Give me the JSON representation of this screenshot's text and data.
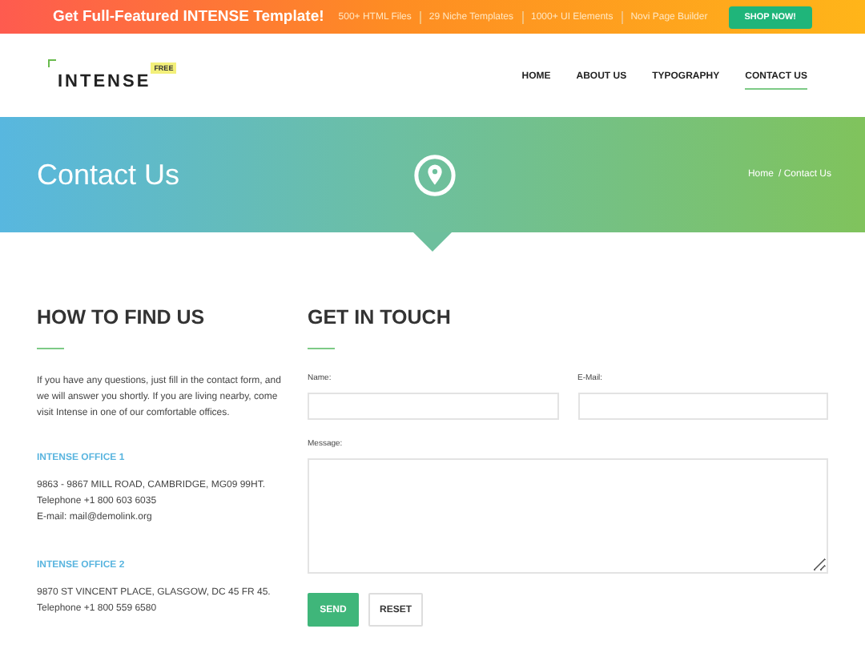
{
  "promo_bar": {
    "title": "Get Full-Featured INTENSE Template!",
    "features": [
      "500+ HTML Files",
      "29 Niche Templates",
      "1000+ UI Elements",
      "Novi Page Builder"
    ],
    "button": "SHOP NOW!"
  },
  "header": {
    "logo": "INTENSE",
    "logo_badge": "FREE",
    "nav": [
      {
        "label": "HOME",
        "selected": false
      },
      {
        "label": "ABOUT US",
        "selected": false
      },
      {
        "label": "TYPOGRAPHY",
        "selected": false
      },
      {
        "label": "CONTACT US",
        "selected": true
      }
    ]
  },
  "hero": {
    "title": "Contact Us",
    "breadcrumbs": [
      "Home",
      "/ Contact Us"
    ]
  },
  "find_us": {
    "heading": "HOW TO FIND US",
    "intro": "If you have any questions, just fill in the contact form, and we will answer you shortly. If you are living nearby, come visit Intense in one of our comfortable offices.",
    "offices": [
      {
        "name": "INTENSE OFFICE 1",
        "lines": [
          "9863 - 9867 MILL ROAD, CAMBRIDGE, MG09 99HT.",
          "Telephone +1 800 603 6035",
          "E-mail: mail@demolink.org"
        ]
      },
      {
        "name": "INTENSE OFFICE 2",
        "lines": [
          "9870 ST VINCENT PLACE, GLASGOW, DC 45 FR 45.",
          "Telephone +1 800 559 6580"
        ]
      }
    ]
  },
  "contact_form": {
    "heading": "GET IN TOUCH",
    "name_label": "Name:",
    "email_label": "E-Mail:",
    "message_label": "Message:",
    "buttons": [
      "SEND",
      "RESET"
    ]
  }
}
